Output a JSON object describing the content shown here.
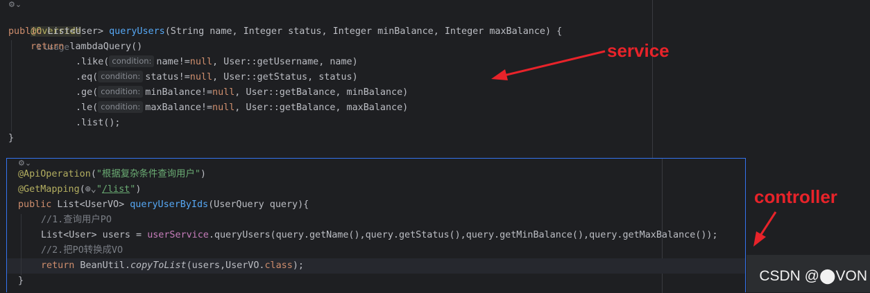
{
  "service_code": {
    "override": "@Override",
    "usage": "1 usage",
    "sig_public": "public",
    "sig_type": " List<User> ",
    "sig_name": "queryUsers",
    "sig_params": "(String name, Integer status, Integer minBalance, Integer maxBalance) {",
    "ret_kw": "return",
    "ret_call": " lambdaQuery()",
    "hint": "condition:",
    "like_pre": ".like(",
    "like_mid": "name!=",
    "like_post": ", User::getUsername, name)",
    "eq_pre": ".eq(",
    "eq_mid": "status!=",
    "eq_post": ", User::getStatus, status)",
    "ge_pre": ".ge(",
    "ge_mid": "minBalance!=",
    "ge_post": ", User::getBalance, minBalance)",
    "le_pre": ".le(",
    "le_mid": "maxBalance!=",
    "le_post": ", User::getBalance, maxBalance)",
    "null_kw": "null",
    "list_call": ".list();",
    "close": "}"
  },
  "controller_code": {
    "api_ann": "@ApiOperation",
    "api_open": "(",
    "api_str": "\"根据复杂条件查询用户\"",
    "api_close": ")",
    "get_ann": "@GetMapping",
    "get_open": "(",
    "globe": "⊕⌄",
    "get_str_q1": "\"",
    "get_str_path": "/list",
    "get_str_q2": "\"",
    "get_close": ")",
    "sig_public": "public",
    "sig_type": " List<UserVO> ",
    "sig_name": "queryUserByIds",
    "sig_params": "(UserQuery query){",
    "cmt1": "//1.查询用户PO",
    "line_users_a": "List<User> users = ",
    "line_users_field": "userService",
    "line_users_b": ".queryUsers(query.getName(),query.getStatus(),query.getMinBalance(),query.getMaxBalance());",
    "cmt2": "//2.把PO转换成VO",
    "ret_kw": "return",
    "ret_a": " BeanUtil.",
    "ret_method": "copyToList",
    "ret_b": "(users,UserVO.",
    "ret_class": "class",
    "ret_c": ");",
    "close": "}"
  },
  "annotations": {
    "service_label": "service",
    "controller_label": "controller",
    "arrow_color": "#e8232a"
  },
  "watermark": "CSDN @⬤VON"
}
